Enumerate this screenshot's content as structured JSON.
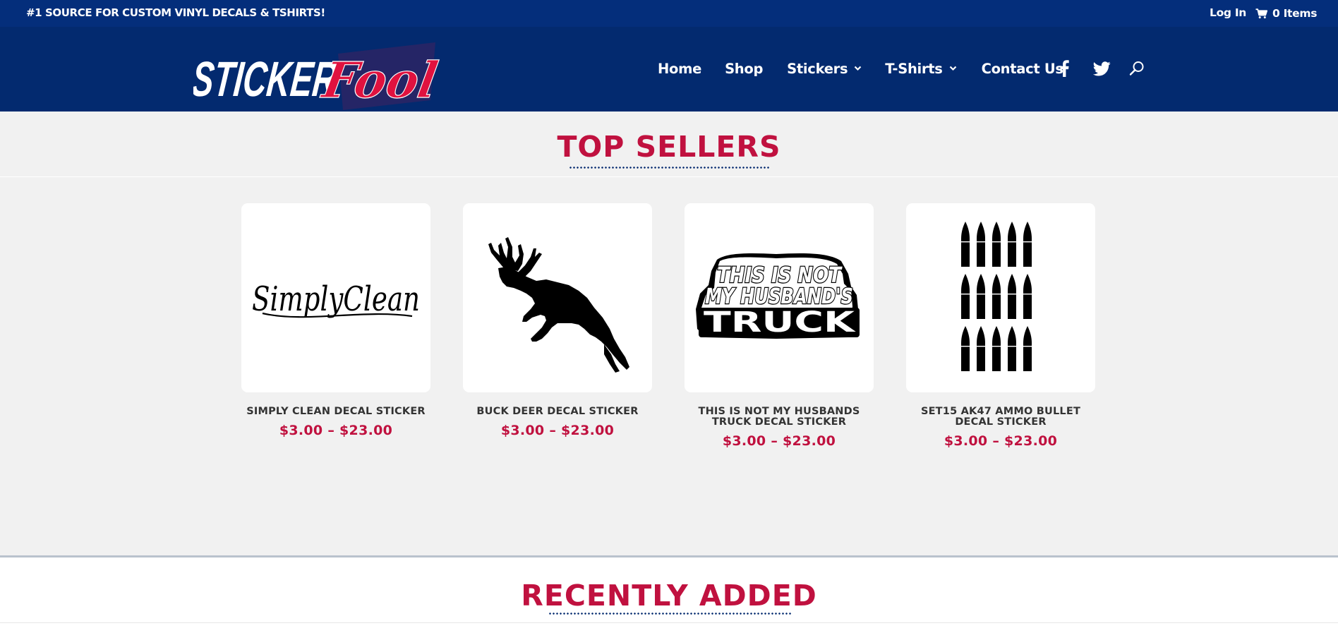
{
  "topbar": {
    "tagline": "#1 SOURCE FOR CUSTOM VINYL DECALS & TSHIRTS!",
    "login": "Log In",
    "cart": "0 Items"
  },
  "brand": {
    "logo_word1": "STICKER",
    "logo_word2": "Fool",
    "colors": {
      "navy": "#032a6f",
      "topbar": "#042e7b",
      "accent": "#c0113f"
    }
  },
  "nav": {
    "items": [
      {
        "label": "Home",
        "dropdown": false
      },
      {
        "label": "Shop",
        "dropdown": false
      },
      {
        "label": "Stickers",
        "dropdown": true
      },
      {
        "label": "T-Shirts",
        "dropdown": true
      },
      {
        "label": "Contact Us",
        "dropdown": false
      }
    ],
    "icons": [
      "facebook-icon",
      "twitter-icon",
      "search-icon"
    ]
  },
  "top_sellers": {
    "title": "TOP SELLERS",
    "products": [
      {
        "name": "SIMPLY CLEAN DECAL STICKER",
        "price": "$3.00 – $23.00",
        "image": "simply-clean-script"
      },
      {
        "name": "BUCK DEER DECAL STICKER",
        "price": "$3.00 – $23.00",
        "image": "leaping-deer"
      },
      {
        "name": "THIS IS NOT MY HUSBANDS TRUCK DECAL STICKER",
        "price": "$3.00 – $23.00",
        "image": "not-my-husbands-truck",
        "image_text": [
          "THIS IS NOT",
          "MY HUSBAND'S",
          "TRUCK"
        ]
      },
      {
        "name": "SET15 AK47 AMMO BULLET DECAL STICKER",
        "price": "$3.00 – $23.00",
        "image": "bullets"
      }
    ]
  },
  "recently_added": {
    "title": "RECENTLY ADDED"
  }
}
